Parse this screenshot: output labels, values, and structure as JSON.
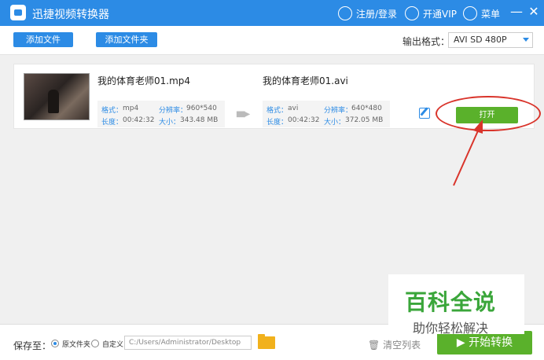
{
  "titlebar": {
    "app_title": "迅捷视频转换器",
    "login": "注册/登录",
    "vip": "开通VIP",
    "menu": "菜单",
    "minimize": "—",
    "close": "✕"
  },
  "toolbar": {
    "add_file": "添加文件",
    "add_folder": "添加文件夹",
    "output_label": "输出格式：",
    "output_value": "AVI  SD 480P"
  },
  "task": {
    "source": {
      "name": "我的体育老师01.mp4",
      "format_label": "格式：",
      "format": "mp4",
      "resolution_label": "分辨率：",
      "resolution": "960*540",
      "duration_label": "长度：",
      "duration": "00:42:32",
      "size_label": "大小：",
      "size": "343.48 MB"
    },
    "target": {
      "name": "我的体育老师01.avi",
      "format_label": "格式：",
      "format": "avi",
      "resolution_label": "分辨率：",
      "resolution": "640*480",
      "duration_label": "长度：",
      "duration": "00:42:32",
      "size_label": "大小：",
      "size": "372.05 MB"
    },
    "open_button": "打开"
  },
  "watermark": {
    "title": "百科全说",
    "subtitle": "助你轻松解决"
  },
  "bottombar": {
    "save_to": "保存至：",
    "option_original": "原文件夹",
    "option_custom": "自定义",
    "path": "C:/Users/Administrator/Desktop",
    "clear_list": "清空列表",
    "start": "开始转换"
  },
  "colors": {
    "brand_blue": "#2c8be5",
    "green": "#5ab12b",
    "annotation_red": "#d9342b"
  }
}
